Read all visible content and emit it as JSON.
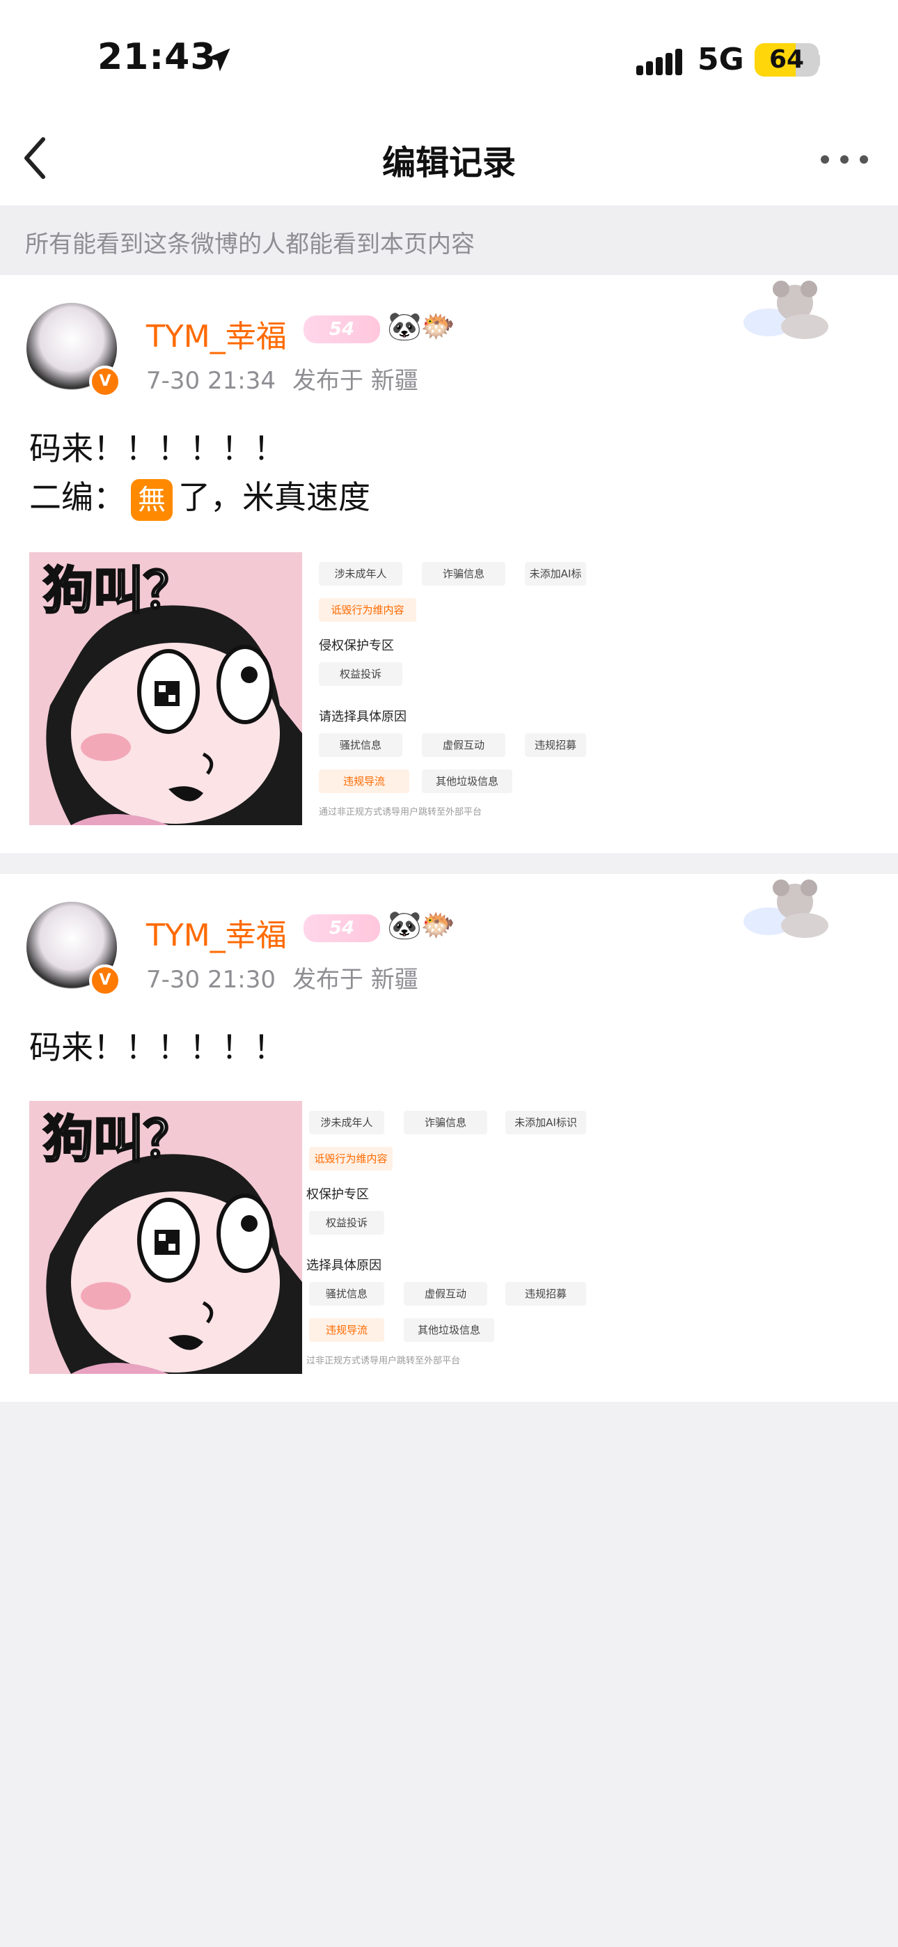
{
  "status_bar": {
    "time": "21:43",
    "network": "5G",
    "battery": "64",
    "battery_level": 0.64,
    "icons": [
      "location-arrow-icon",
      "signal-icon",
      "battery-icon"
    ]
  },
  "nav": {
    "title": "编辑记录",
    "icons": [
      "chevron-left-icon",
      "more-icon"
    ]
  },
  "notice": "所有能看到这条微博的人都能看到本页内容",
  "posts": [
    {
      "username": "TYM_幸福",
      "level": "54",
      "badges": [
        "🐼",
        "🐡"
      ],
      "time": "7-30 21:34",
      "location": "发布于 新疆",
      "text_line1": "码来！！！！！！",
      "text_line2_prefix": "二编：",
      "text_line2_emoji": "無",
      "text_line2_suffix": "了，米真速度",
      "meme_text": "狗叫？",
      "screenshot": {
        "chips_row1": [
          "涉未成年人",
          "诈骗信息",
          "未添加AI标"
        ],
        "chip_selected": "诋毁行为维内容",
        "section1": "侵权保护专区",
        "chip_rights": "权益投诉",
        "section2": "请选择具体原因",
        "chips_row2": [
          "骚扰信息",
          "虚假互动",
          "违规招募"
        ],
        "chips_row3": [
          "违规导流",
          "其他垃圾信息"
        ],
        "hint": "通过非正规方式诱导用户跳转至外部平台"
      }
    },
    {
      "username": "TYM_幸福",
      "level": "54",
      "badges": [
        "🐼",
        "🐡"
      ],
      "time": "7-30 21:30",
      "location": "发布于 新疆",
      "text_line1": "码来！！！！！！",
      "meme_text": "狗叫？",
      "screenshot": {
        "chips_row1": [
          "涉未成年人",
          "诈骗信息",
          "未添加AI标识"
        ],
        "chip_selected": "诋毁行为维内容",
        "section1": "权保护专区",
        "chip_rights": "权益投诉",
        "section2": "选择具体原因",
        "chips_row2": [
          "骚扰信息",
          "虚假互动",
          "违规招募"
        ],
        "chips_row3": [
          "违规导流",
          "其他垃圾信息"
        ],
        "hint": "过非正规方式诱导用户跳转至外部平台"
      }
    }
  ]
}
